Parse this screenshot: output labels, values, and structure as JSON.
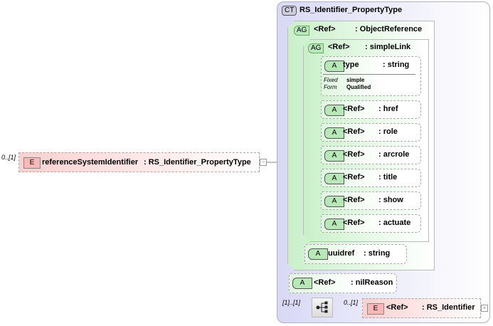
{
  "element": {
    "occurrence": "0..[1]",
    "badge": "E",
    "name": "referenceSystemIdentifier",
    "type": ": RS_Identifier_PropertyType",
    "toggle": "−"
  },
  "complex_type": {
    "badge": "CT",
    "name": "RS_Identifier_PropertyType"
  },
  "object_reference": {
    "badge": "AG",
    "ref": "<Ref>",
    "type": ": ObjectReference"
  },
  "simple_link": {
    "badge": "AG",
    "ref": "<Ref>",
    "type": ": simpleLink"
  },
  "type_attr": {
    "badge": "A",
    "name": "type",
    "type": ": string",
    "fixed_label": "Fixed",
    "fixed_value": "simple",
    "form_label": "Form",
    "form_value": "Qualified"
  },
  "attributes": [
    {
      "badge": "A",
      "ref": "<Ref>",
      "type": ": href"
    },
    {
      "badge": "A",
      "ref": "<Ref>",
      "type": ": role"
    },
    {
      "badge": "A",
      "ref": "<Ref>",
      "type": ": arcrole"
    },
    {
      "badge": "A",
      "ref": "<Ref>",
      "type": ": title"
    },
    {
      "badge": "A",
      "ref": "<Ref>",
      "type": ": show"
    },
    {
      "badge": "A",
      "ref": "<Ref>",
      "type": ": actuate"
    }
  ],
  "uuidref": {
    "badge": "A",
    "name": "uuidref",
    "type": ": string"
  },
  "nil_reason": {
    "badge": "A",
    "ref": "<Ref>",
    "type": ": nilReason"
  },
  "sequence": {
    "occurrence": "[1]..[1]"
  },
  "rs_identifier": {
    "occurrence": "0..[1]",
    "badge": "E",
    "ref": "<Ref>",
    "type": ": RS_Identifier",
    "toggle": "+"
  }
}
